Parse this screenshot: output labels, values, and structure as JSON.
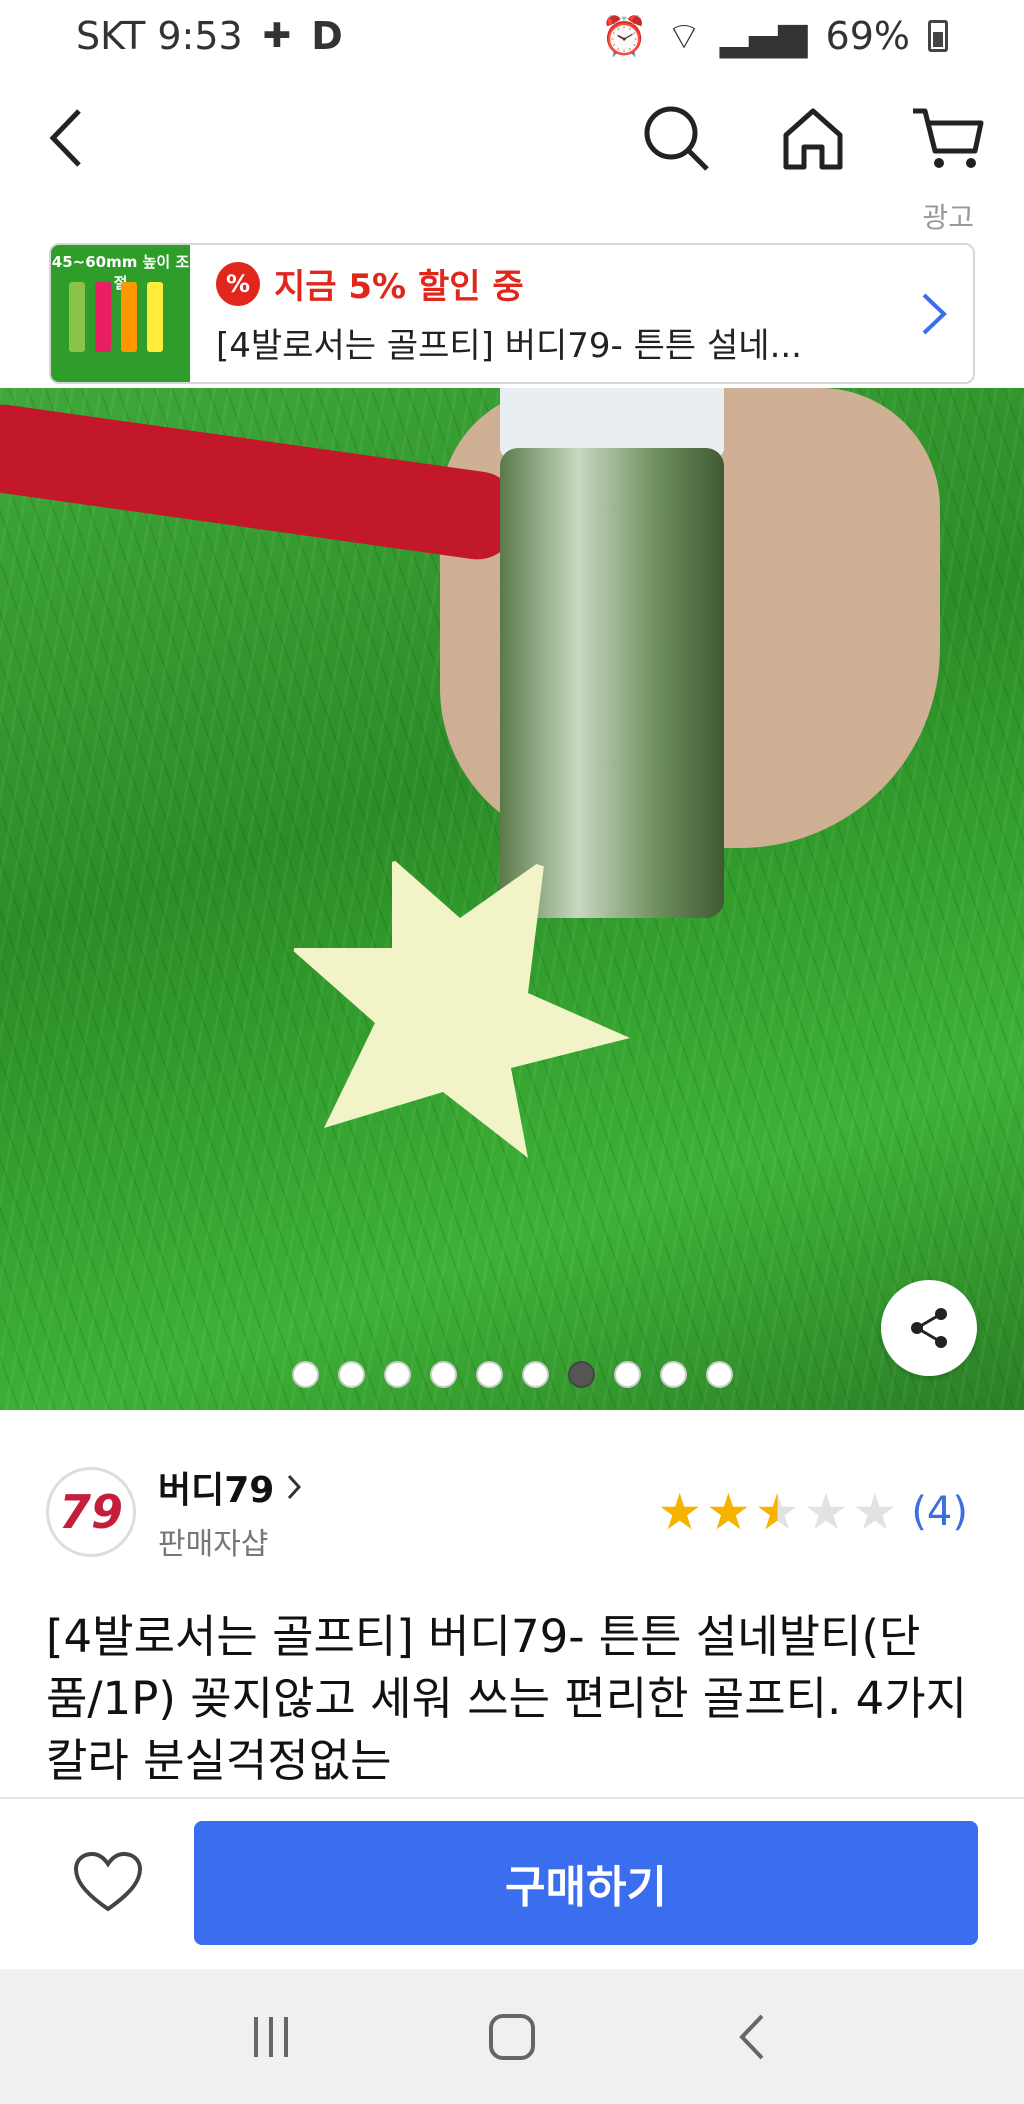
{
  "status_bar": {
    "carrier_time": "SKT 9:53",
    "battery": "69%"
  },
  "nav": {
    "back_icon": "chevron-left-icon",
    "search_icon": "search-icon",
    "home_icon": "home-icon",
    "cart_icon": "cart-icon"
  },
  "ad": {
    "label": "광고",
    "thumb_caption": "45~60mm 높이 조절",
    "discount_badge": "%",
    "discount_text": "지금 5% 할인 중",
    "product_title": "[4발로서는 골프티] 버디79- 튼튼 설네..."
  },
  "hero": {
    "image_count": 10,
    "active_index": 6,
    "share_icon": "share-icon"
  },
  "seller": {
    "logo_text": "79",
    "name": "버디79",
    "subtitle": "판매자샵",
    "rating": 2.5,
    "review_count": "(4)"
  },
  "product": {
    "title": "[4발로서는 골프티] 버디79- 튼튼 설네발티(단품/1P) 꽂지않고 세워 쓰는 편리한 골프티. 4가지칼라 분실걱정없는"
  },
  "bottom_bar": {
    "wishlist_icon": "heart-icon",
    "buy_label": "구매하기"
  },
  "colors": {
    "accent_blue": "#3a6eef",
    "discount_red": "#e1261c",
    "star_yellow": "#f5b300"
  }
}
